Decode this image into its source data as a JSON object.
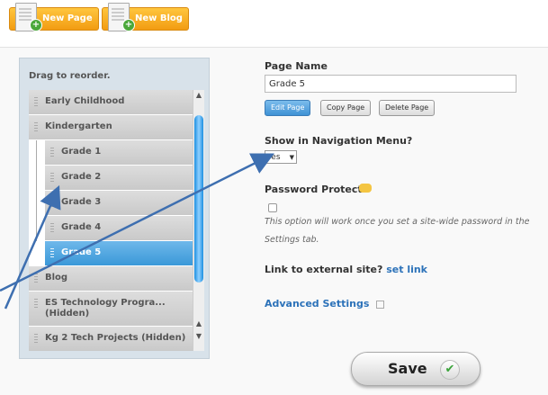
{
  "toolbar": {
    "new_page": "New Page",
    "new_blog": "New Blog"
  },
  "panel": {
    "hint": "Drag to reorder.",
    "items": [
      {
        "label": "Early Childhood"
      },
      {
        "label": "Kindergarten"
      },
      {
        "label": "Grade 1"
      },
      {
        "label": "Grade 2"
      },
      {
        "label": "Grade 3"
      },
      {
        "label": "Grade 4"
      },
      {
        "label": "Grade 5"
      },
      {
        "label": "Blog"
      },
      {
        "label": "ES Technology Progra... (Hidden)"
      },
      {
        "label": "Kg 2 Tech Projects (Hidden)"
      }
    ],
    "selected": "Grade 5"
  },
  "form": {
    "page_name_label": "Page Name",
    "page_name_value": "Grade 5",
    "edit_page": "Edit Page",
    "copy_page": "Copy Page",
    "delete_page": "Delete Page",
    "nav_label": "Show in Navigation Menu?",
    "nav_value": "Yes",
    "password_label": "Password Protect?",
    "password_note": "This option will work once you set a site-wide password in the Settings tab.",
    "external_label": "Link to external site?",
    "set_link": "set link",
    "advanced": "Advanced Settings",
    "save": "Save"
  },
  "colors": {
    "toolbar_button": "#f29c12",
    "selected_item": "#3a98d8",
    "link": "#2c72b9",
    "annotation_arrow": "#3e6fb0"
  },
  "icons": [
    "document-plus-icon",
    "blog-doc-plus-icon",
    "grip-icon",
    "key-icon",
    "checkmark-icon"
  ]
}
